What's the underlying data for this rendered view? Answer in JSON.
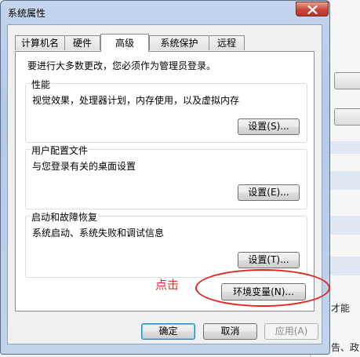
{
  "window": {
    "title": "系统属性"
  },
  "tabs": [
    {
      "label": "计算机名"
    },
    {
      "label": "硬件"
    },
    {
      "label": "高级",
      "active": true
    },
    {
      "label": "系统保护"
    },
    {
      "label": "远程"
    }
  ],
  "advanced": {
    "admin_note": "要进行大多数更改，您必须作为管理员登录。",
    "performance": {
      "title": "性能",
      "description": "视觉效果，处理器计划，内存使用，以及虚拟内存",
      "button": "设置(S)..."
    },
    "user_profiles": {
      "title": "用户配置文件",
      "description": "与您登录有关的桌面设置",
      "button": "设置(E)..."
    },
    "startup_recovery": {
      "title": "启动和故障恢复",
      "description": "系统启动、系统失败和调试信息",
      "button": "设置(T)..."
    },
    "env_button": "环境变量(N)..."
  },
  "annotation": {
    "text": "点击",
    "color": "#e0302a"
  },
  "footer": {
    "ok": "确定",
    "cancel": "取消",
    "apply": "应用(A)"
  },
  "background": {
    "text_1": "才能",
    "text_2": "告、政"
  },
  "icons": {
    "close": "close-icon"
  }
}
